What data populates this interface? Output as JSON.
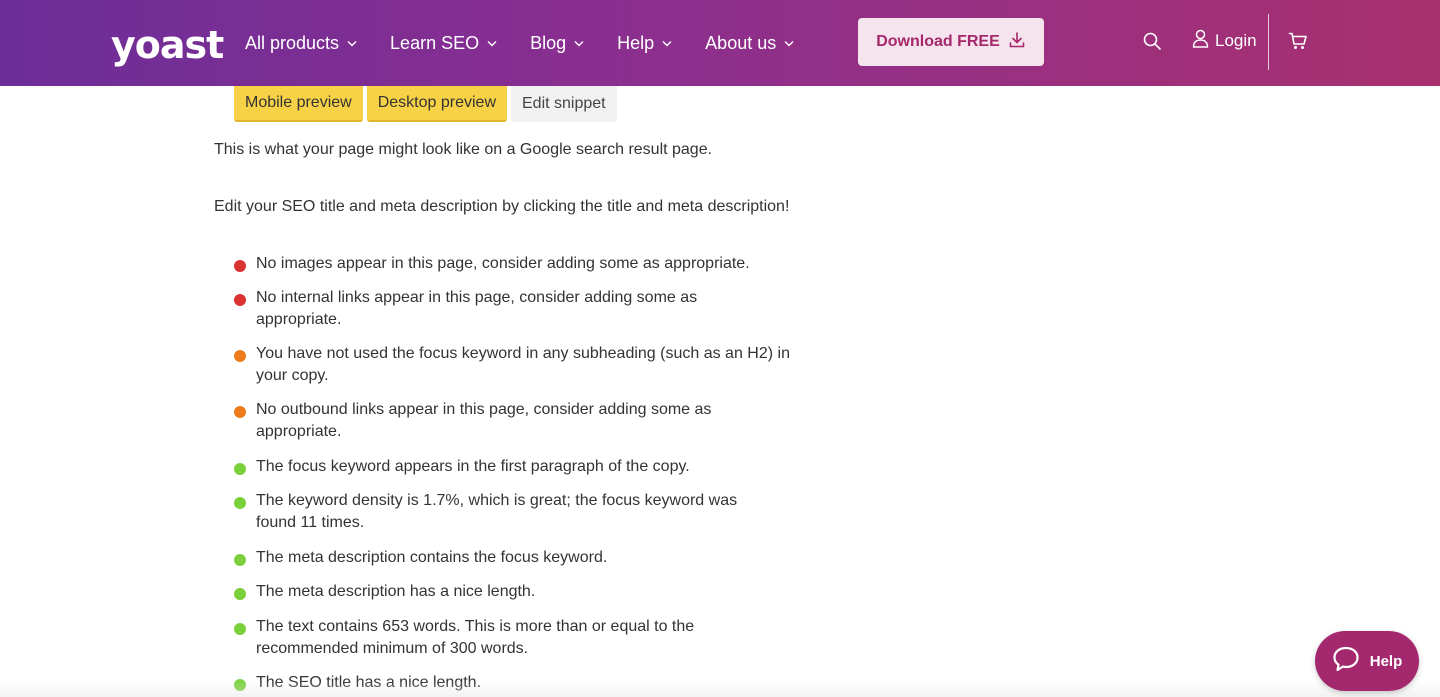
{
  "header": {
    "logo_text": "yoast",
    "nav": [
      {
        "label": "All products"
      },
      {
        "label": "Learn SEO"
      },
      {
        "label": "Blog"
      },
      {
        "label": "Help"
      },
      {
        "label": "About us"
      }
    ],
    "download_label": "Download FREE",
    "login_label": "Login",
    "icons": {
      "search": "search-icon",
      "user": "user-icon",
      "cart": "cart-icon",
      "download": "download-icon"
    }
  },
  "tabs": [
    {
      "label": "Mobile preview",
      "active": true
    },
    {
      "label": "Desktop preview",
      "active": true
    },
    {
      "label": "Edit snippet",
      "active": false
    }
  ],
  "content": {
    "intro": "This is what your page might look like on a Google search result page.",
    "instruction": "Edit your SEO title and meta description by clicking the title and meta description!"
  },
  "checks": [
    {
      "status": "bad",
      "text": "No images appear in this page, consider adding some as appropriate."
    },
    {
      "status": "bad",
      "text": "No internal links appear in this page, consider adding some as appropriate."
    },
    {
      "status": "ok",
      "text": "You have not used the focus keyword in any subheading (such as an H2) in your copy."
    },
    {
      "status": "ok",
      "text": "No outbound links appear in this page, consider adding some as appropriate."
    },
    {
      "status": "good",
      "text": "The focus keyword appears in the first paragraph of the copy."
    },
    {
      "status": "good",
      "text": "The keyword density is 1.7%, which is great; the focus keyword was found 11 times."
    },
    {
      "status": "good",
      "text": "The meta description contains the focus keyword."
    },
    {
      "status": "good",
      "text": "The meta description has a nice length."
    },
    {
      "status": "good",
      "text": "The text contains 653 words. This is more than or equal to the recommended minimum of 300 words."
    },
    {
      "status": "good",
      "text": "The SEO title has a nice length."
    }
  ],
  "status_colors": {
    "bad": "#dc3232",
    "ok": "#ee7c1b",
    "good": "#7ad03a"
  },
  "colors": {
    "brand_purple": "#6c2d98",
    "brand_pink": "#a4286a",
    "tab_yellow": "#f8d246"
  },
  "help_widget": {
    "label": "Help"
  }
}
